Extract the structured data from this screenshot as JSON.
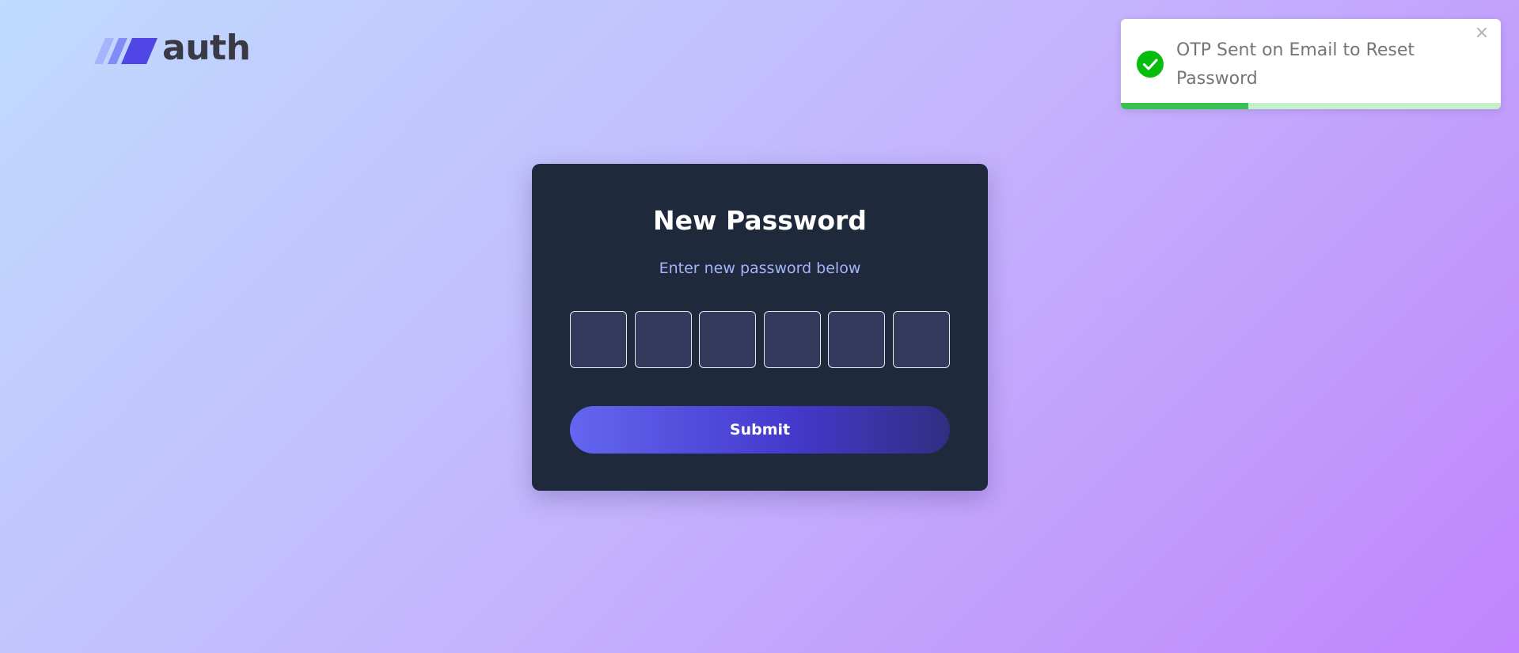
{
  "logo": {
    "text": "auth",
    "icon": "slanted-stripes-logo-icon",
    "stripe_colors": [
      "#a5b4fc",
      "#818cf8",
      "#4f46e5"
    ]
  },
  "card": {
    "title": "New Password",
    "subtitle": "Enter new password below",
    "otp_inputs": [
      {
        "value": ""
      },
      {
        "value": ""
      },
      {
        "value": ""
      },
      {
        "value": ""
      },
      {
        "value": ""
      },
      {
        "value": ""
      }
    ],
    "submit_label": "Submit"
  },
  "toast": {
    "message": "OTP Sent on Email to Reset Password",
    "icon": "check-circle-icon",
    "close_icon": "close-icon",
    "close_glyph": "×",
    "progress_remaining": 0.335,
    "status_color": "#3ac153"
  },
  "colors": {
    "card_bg": "#1e293b",
    "accent": "#6366f1",
    "subtitle": "#a5b4fc"
  }
}
